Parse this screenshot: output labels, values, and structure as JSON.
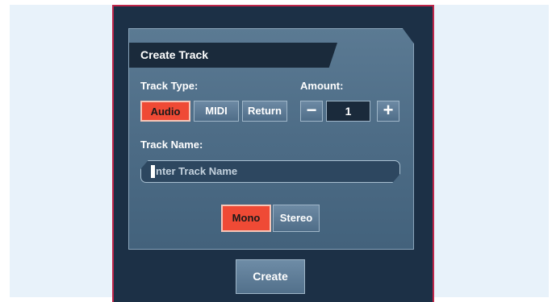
{
  "panel": {
    "title": "Create Track",
    "track_type": {
      "label": "Track Type:",
      "options": [
        "Audio",
        "MIDI",
        "Return"
      ],
      "selected": "Audio"
    },
    "amount": {
      "label": "Amount:",
      "value": "1",
      "minus": "−",
      "plus": "+"
    },
    "track_name": {
      "label": "Track Name:",
      "placeholder": "nter Track Name"
    },
    "channel": {
      "options": [
        "Mono",
        "Stereo"
      ],
      "selected": "Mono"
    }
  },
  "actions": {
    "create_label": "Create"
  },
  "colors": {
    "accent_active": "#ef4a35",
    "panel": "#4d6c86",
    "window": "#1c3046"
  }
}
